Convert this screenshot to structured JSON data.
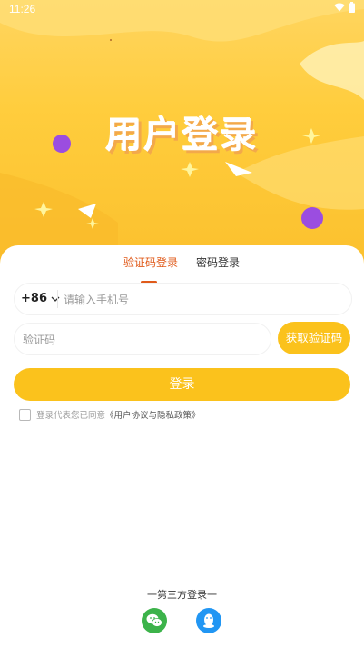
{
  "status_bar": {
    "time": "11:26"
  },
  "hero": {
    "title": "用户登录"
  },
  "tabs": [
    {
      "label": "验证码登录",
      "active": true
    },
    {
      "label": "密码登录",
      "active": false
    }
  ],
  "phone": {
    "country_code": "+86",
    "placeholder": "请输入手机号",
    "value": ""
  },
  "code": {
    "placeholder": "验证码",
    "value": "",
    "get_code_label": "获取验证码"
  },
  "login_label": "登录",
  "agreement": {
    "text": "登录代表您已同意",
    "link": "《用户协议与隐私政策》",
    "checked": false
  },
  "third_party": {
    "title": "一第三方登录一",
    "providers": [
      {
        "icon": "wechat-icon",
        "color": "#3cb34a"
      },
      {
        "icon": "qq-icon",
        "color": "#2196f3"
      }
    ]
  },
  "colors": {
    "accent": "#fbc21c",
    "tab_active": "#e05a1a",
    "hero_bg": "#ffcd3d"
  }
}
